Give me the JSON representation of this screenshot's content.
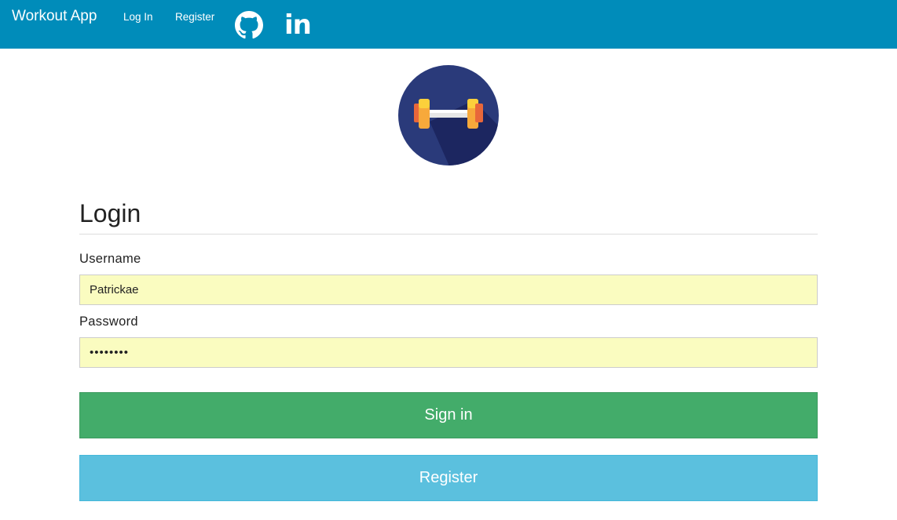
{
  "navbar": {
    "brand": "Workout App",
    "links": [
      "Log In",
      "Register"
    ],
    "icons": [
      "github-icon",
      "linkedin-icon"
    ],
    "linkedin_text": "in",
    "background": "#008cba"
  },
  "logo": {
    "icon": "dumbbell-icon"
  },
  "form": {
    "title": "Login",
    "username_label": "Username",
    "username_value": "Patrickae",
    "password_label": "Password",
    "password_value": "••••••••",
    "signin_label": "Sign in",
    "register_label": "Register"
  },
  "colors": {
    "signin": "#43ac6a",
    "register": "#5bc0de",
    "input_fill": "#fafcc0"
  }
}
